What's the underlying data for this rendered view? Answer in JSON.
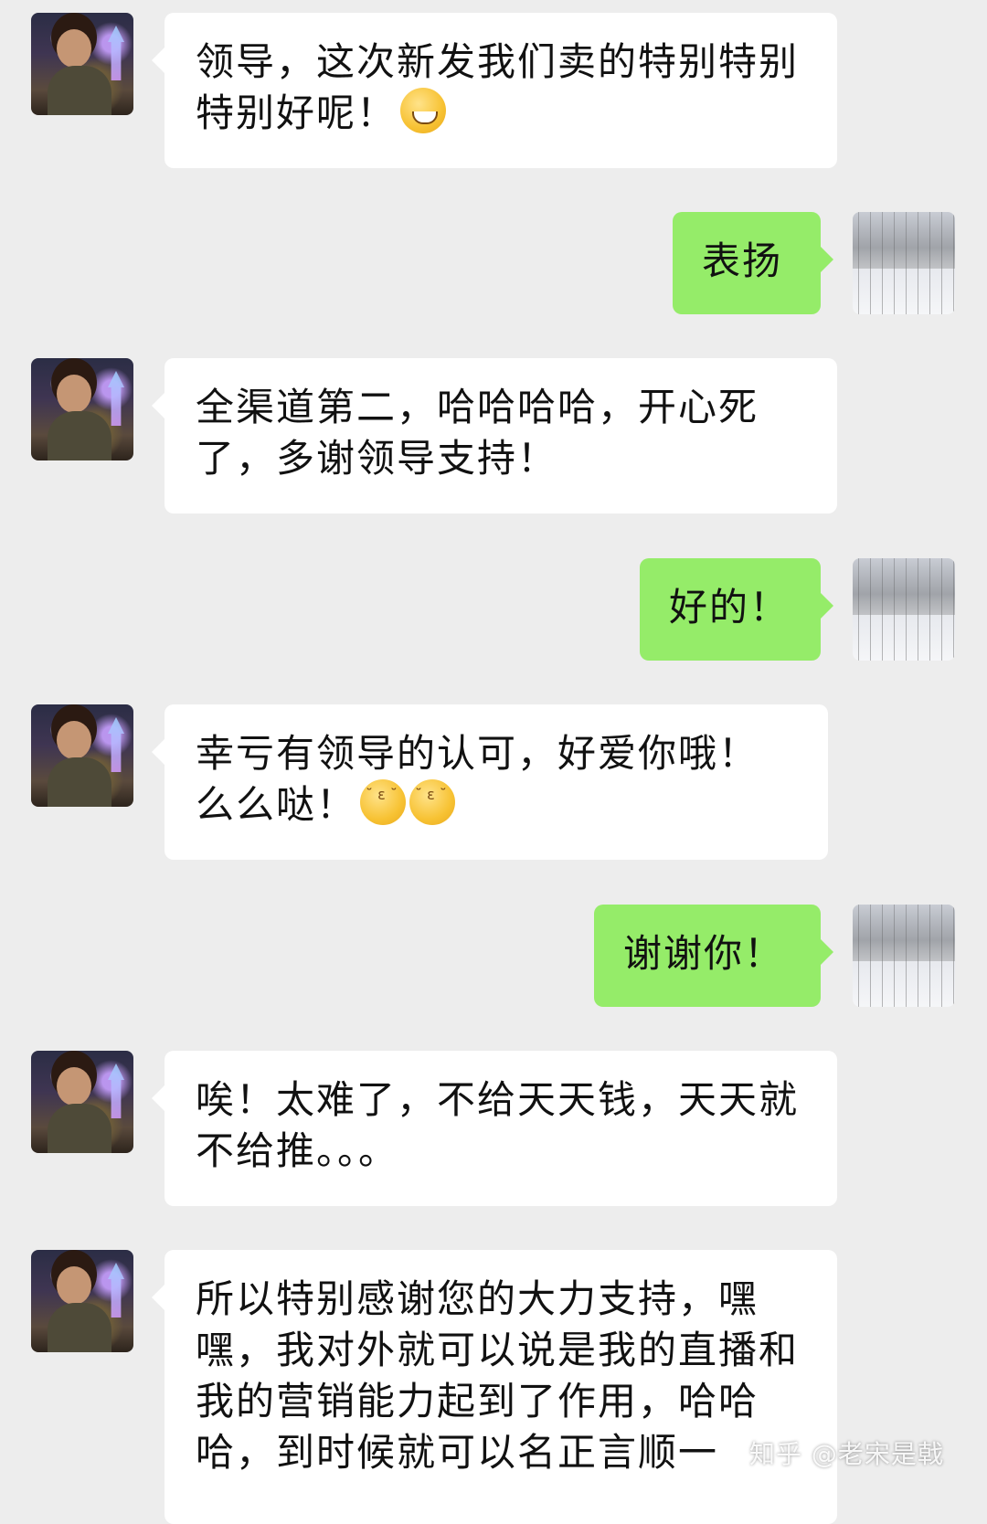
{
  "messages": [
    {
      "side": "left",
      "text": "领导，这次新发我们卖的特别特别特别好呢！",
      "emoji": "grin-icon"
    },
    {
      "side": "right",
      "text": "表扬"
    },
    {
      "side": "left",
      "text": "全渠道第二，哈哈哈哈，开心死了，多谢领导支持！"
    },
    {
      "side": "right",
      "text": "好的！"
    },
    {
      "side": "left",
      "text": "幸亏有领导的认可，好爱你哦！么么哒！",
      "emoji": "kiss-icon x2"
    },
    {
      "side": "right",
      "text": "谢谢你！"
    },
    {
      "side": "left",
      "text": "唉！太难了，不给天天钱，天天就不给推。。。"
    },
    {
      "side": "left",
      "text": "所以特别感谢您的大力支持，嘿嘿，我对外就可以说是我的直播和我的营销能力起到了作用，哈哈哈，到时候就可以名正言顺一"
    }
  ],
  "watermark": "知乎 @老宋是戟",
  "colors": {
    "background": "#ededed",
    "incoming_bubble": "#ffffff",
    "outgoing_bubble": "#95ec69"
  }
}
